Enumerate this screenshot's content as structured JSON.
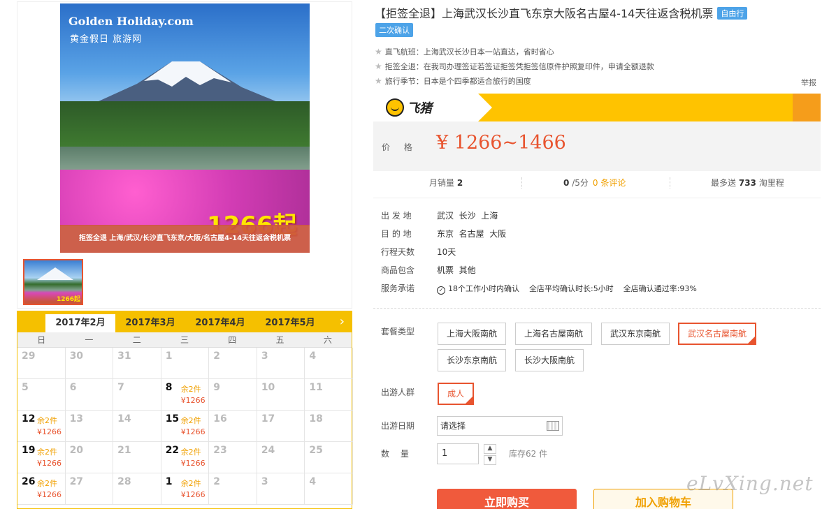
{
  "product": {
    "title": "【拒签全退】上海武汉长沙直飞东京大阪名古屋4-14天往返含税机票",
    "tag": "自由行",
    "tag2": "二次确认",
    "bullets": [
      "直飞航班：上海武汉长沙日本一站直达，省时省心",
      "拒签全退：在我司办理签证若签证拒签凭拒签信原件护照复印件，申请全额退款",
      "旅行季节：日本是个四季都适合旅行的国度"
    ],
    "report": "举报"
  },
  "image": {
    "logo_en": "Golden Holiday.com",
    "logo_cn": "黄金假日 旅游网",
    "promo": "1266起",
    "caption": "拒签全退 上海/武汉/长沙直飞东京/大阪/名古屋4-14天往返含税机票",
    "thumb_promo": "1266起"
  },
  "price": {
    "brand": "飞猪",
    "label": "价 格",
    "value": "¥ 1266~1466"
  },
  "stats": {
    "monthly_label": "月销量",
    "monthly_value": "2",
    "rating_value": "0",
    "rating_suffix": "/5分",
    "reviews": "0 条评论",
    "points_prefix": "最多送",
    "points_value": "733",
    "points_suffix": "淘里程"
  },
  "attrs": {
    "depart_k": "出 发 地",
    "depart_v": "武汉  长沙  上海",
    "dest_k": "目 的 地",
    "dest_v": "东京  名古屋  大阪",
    "days_k": "行程天数",
    "days_v": "10天",
    "incl_k": "商品包含",
    "incl_v": "机票  其他",
    "svc_k": "服务承诺",
    "svc_v": "18个工作小时内确认    全店平均确认时长:5小时    全店确认通过率:93%"
  },
  "options": {
    "package_label": "套餐类型",
    "packages": [
      "上海大阪南航",
      "上海名古屋南航",
      "武汉东京南航",
      "武汉名古屋南航",
      "长沙东京南航",
      "长沙大阪南航"
    ],
    "crowd_label": "出游人群",
    "crowd": "成人",
    "date_label": "出游日期",
    "date_placeholder": "请选择",
    "qty_label": "数　 量",
    "qty_value": "1",
    "stock": "库存62 件"
  },
  "buttons": {
    "buy": "立即购买",
    "cart": "加入购物车"
  },
  "calendar": {
    "months": [
      "2017年2月",
      "2017年3月",
      "2017年4月",
      "2017年5月"
    ],
    "weekdays": [
      "日",
      "一",
      "二",
      "三",
      "四",
      "五",
      "六"
    ],
    "days": [
      {
        "d": "29"
      },
      {
        "d": "30"
      },
      {
        "d": "31"
      },
      {
        "d": "1"
      },
      {
        "d": "2"
      },
      {
        "d": "3"
      },
      {
        "d": "4"
      },
      {
        "d": "5"
      },
      {
        "d": "6"
      },
      {
        "d": "7"
      },
      {
        "d": "8",
        "rem": "余2件",
        "pr": "¥1266"
      },
      {
        "d": "9"
      },
      {
        "d": "10"
      },
      {
        "d": "11"
      },
      {
        "d": "12",
        "rem": "余2件",
        "pr": "¥1266"
      },
      {
        "d": "13"
      },
      {
        "d": "14"
      },
      {
        "d": "15",
        "rem": "余2件",
        "pr": "¥1266"
      },
      {
        "d": "16"
      },
      {
        "d": "17"
      },
      {
        "d": "18"
      },
      {
        "d": "19",
        "rem": "余2件",
        "pr": "¥1266"
      },
      {
        "d": "20"
      },
      {
        "d": "21"
      },
      {
        "d": "22",
        "rem": "余2件",
        "pr": "¥1266"
      },
      {
        "d": "23"
      },
      {
        "d": "24"
      },
      {
        "d": "25"
      },
      {
        "d": "26",
        "rem": "余2件",
        "pr": "¥1266"
      },
      {
        "d": "27"
      },
      {
        "d": "28"
      },
      {
        "d": "1",
        "rem": "余2件",
        "pr": "¥1266"
      },
      {
        "d": "2"
      },
      {
        "d": "3"
      },
      {
        "d": "4"
      }
    ]
  },
  "watermark": "eLvXing.net",
  "colors": {
    "accent": "#e8542f",
    "brand_yellow": "#ffc300",
    "tag_blue": "#4da3e8",
    "stock_orange": "#f0a000"
  }
}
